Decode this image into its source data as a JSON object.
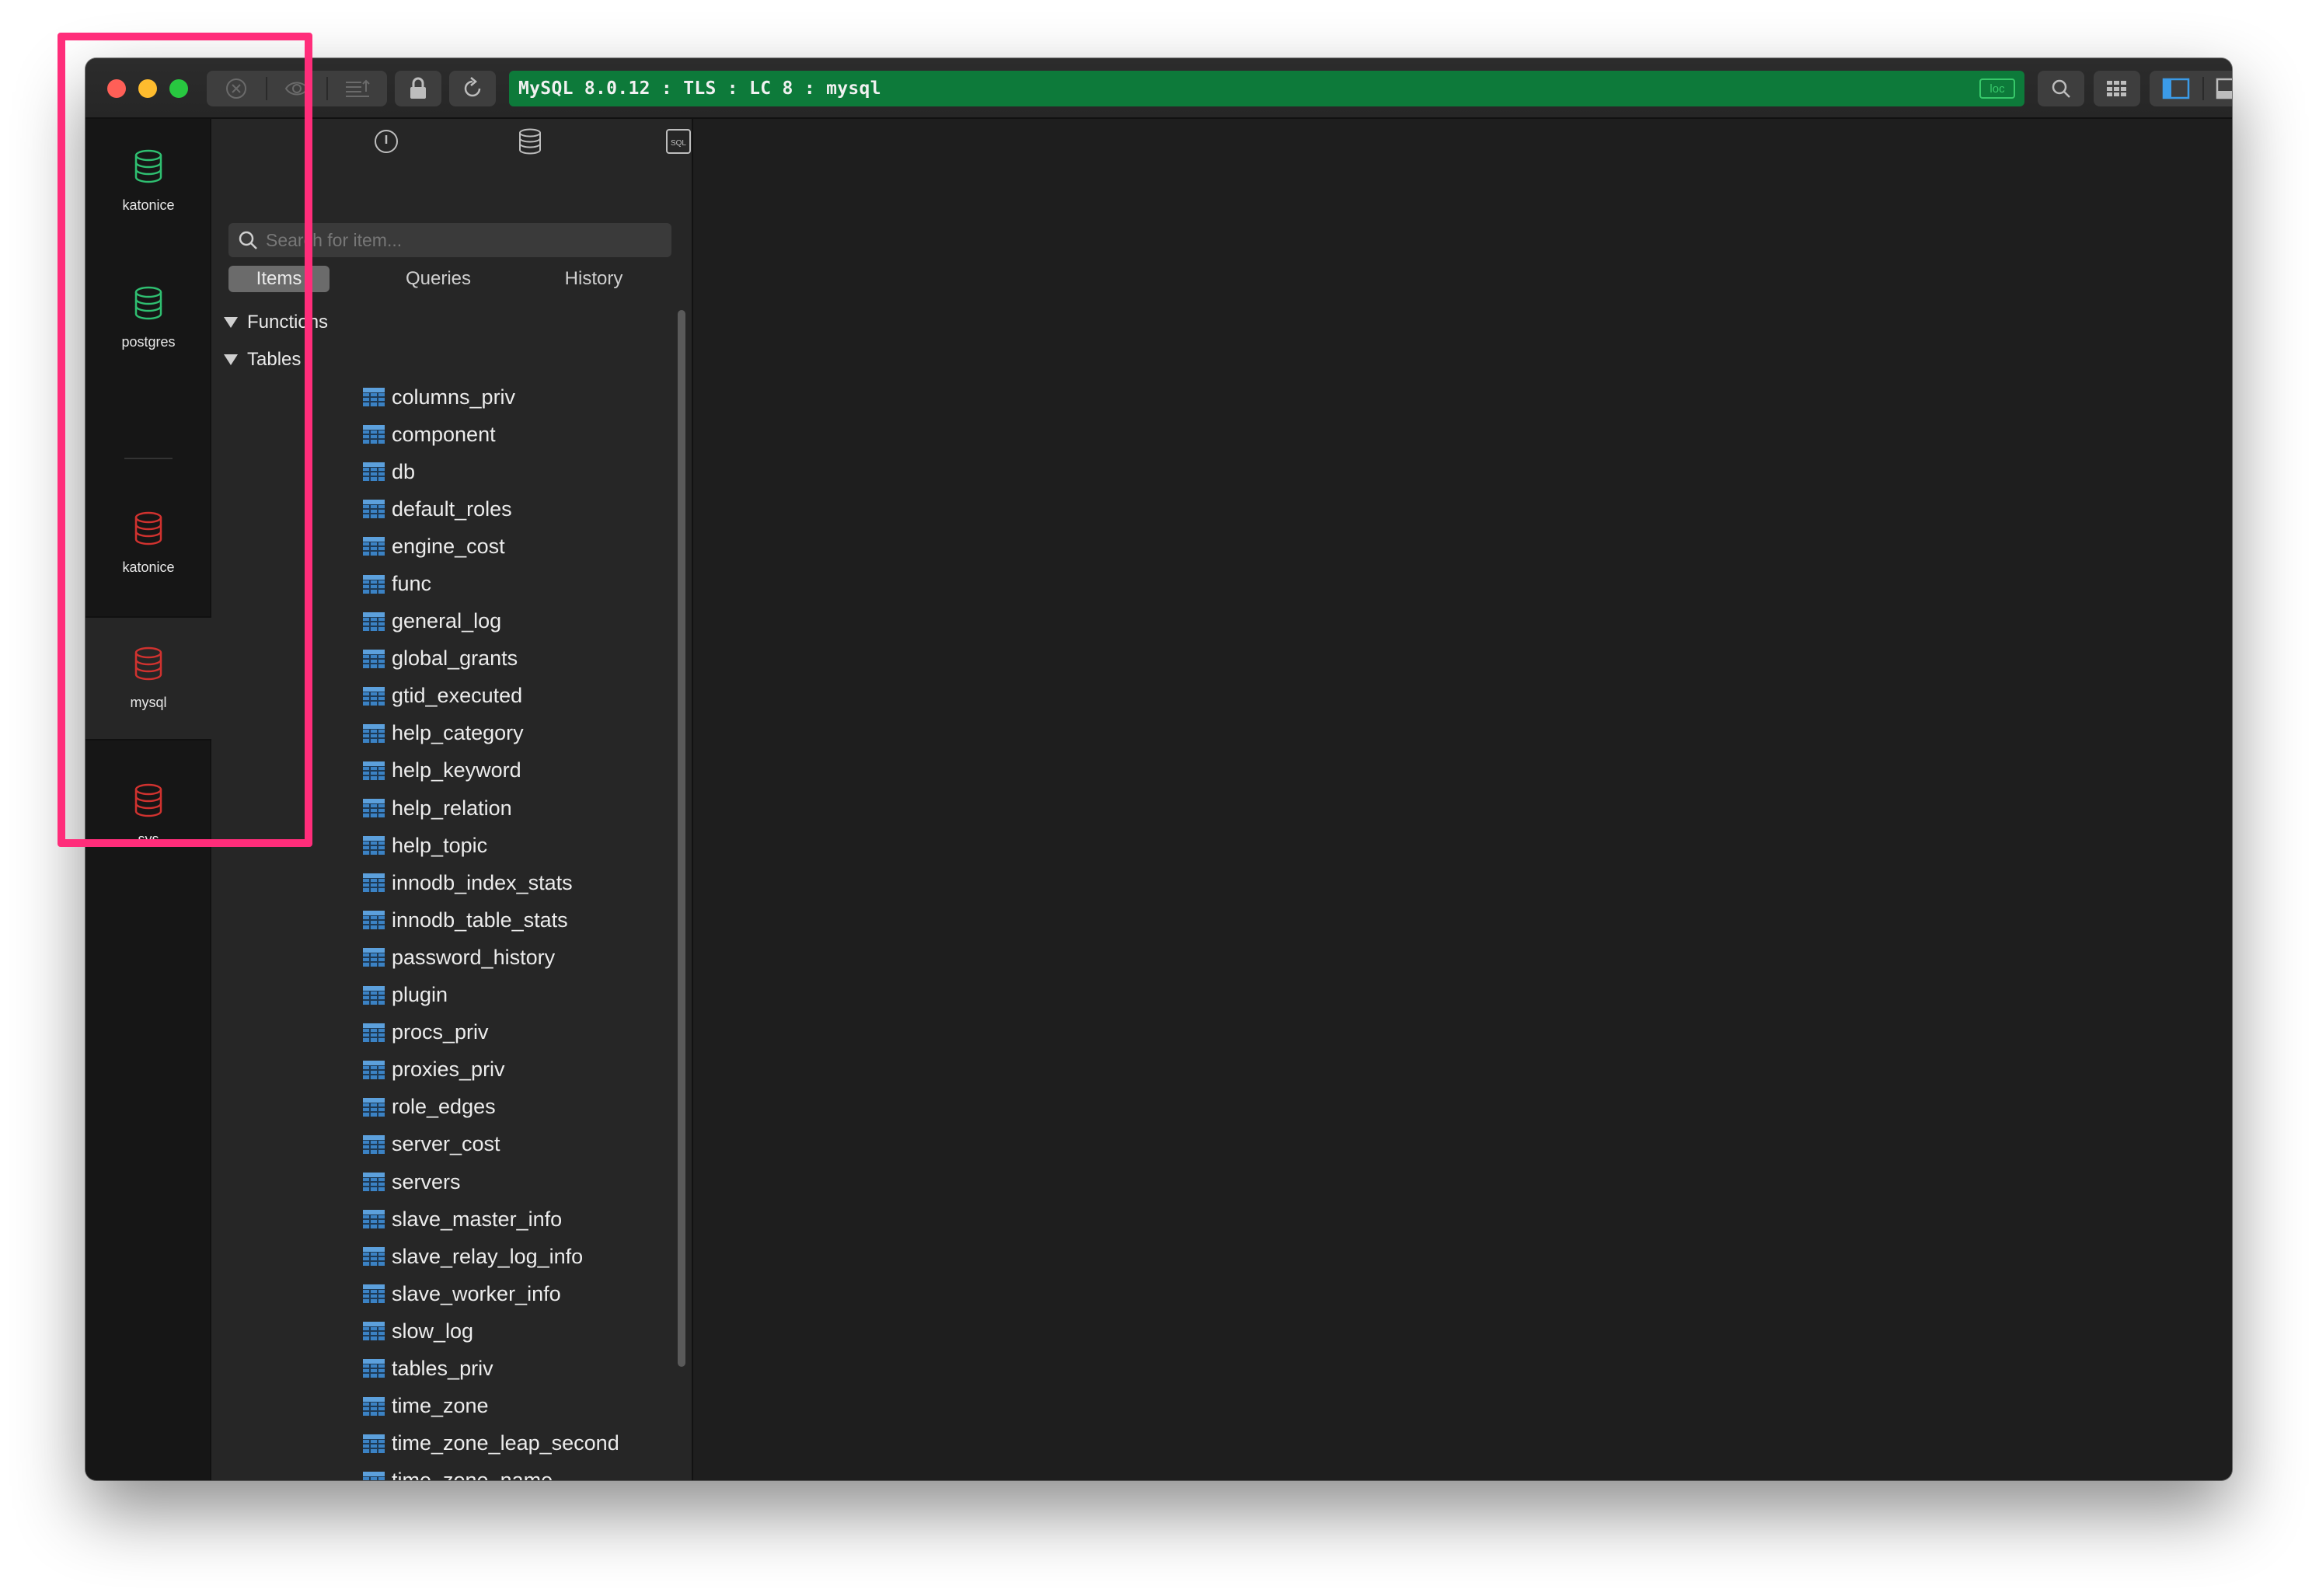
{
  "titlebar": {
    "status_text": "MySQL 8.0.12 : TLS : LC 8 : mysql",
    "loc_badge": "loc",
    "status_color": "#0d7a3a"
  },
  "connections": [
    {
      "label": "katonice",
      "color": "#2fbf71",
      "icon": "database-icon"
    },
    {
      "label": "postgres",
      "color": "#2fbf71",
      "icon": "database-icon"
    },
    {
      "label": "katonice",
      "color": "#d0322f",
      "icon": "database-icon"
    },
    {
      "label": "mysql",
      "color": "#d0322f",
      "icon": "database-icon",
      "active": true
    },
    {
      "label": "sys",
      "color": "#d0322f",
      "icon": "database-icon"
    }
  ],
  "sidebar": {
    "search_placeholder": "Search for item...",
    "tabs": {
      "items": "Items",
      "queries": "Queries",
      "history": "History"
    },
    "groups": {
      "functions": "Functions",
      "tables": "Tables"
    },
    "tables": [
      "columns_priv",
      "component",
      "db",
      "default_roles",
      "engine_cost",
      "func",
      "general_log",
      "global_grants",
      "gtid_executed",
      "help_category",
      "help_keyword",
      "help_relation",
      "help_topic",
      "innodb_index_stats",
      "innodb_table_stats",
      "password_history",
      "plugin",
      "procs_priv",
      "proxies_priv",
      "role_edges",
      "server_cost",
      "servers",
      "slave_master_info",
      "slave_relay_log_info",
      "slave_worker_info",
      "slow_log",
      "tables_priv",
      "time_zone",
      "time_zone_leap_second",
      "time_zone_name"
    ]
  },
  "colors": {
    "highlight": "#ff2d7a",
    "accent_blue": "#3b82c4",
    "connected_green": "#2fbf71",
    "database_red": "#d0322f"
  }
}
